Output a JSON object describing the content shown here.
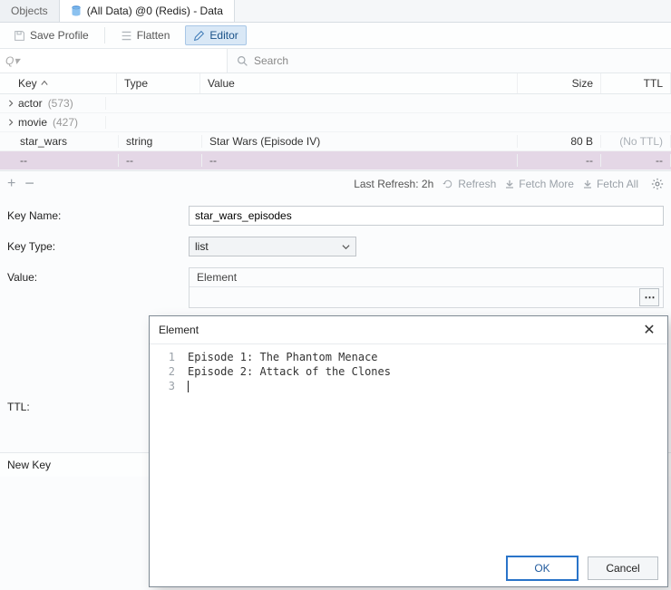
{
  "tabs": {
    "objects": "Objects",
    "active": "(All Data) @0 (Redis) - Data"
  },
  "toolbar": {
    "save_profile": "Save Profile",
    "flatten": "Flatten",
    "editor": "Editor"
  },
  "search": {
    "placeholder": "Q▾",
    "button": "Search"
  },
  "columns": {
    "key": "Key",
    "type": "Type",
    "value": "Value",
    "size": "Size",
    "ttl": "TTL"
  },
  "rows": {
    "actor": {
      "name": "actor",
      "count": "(573)"
    },
    "movie": {
      "name": "movie",
      "count": "(427)"
    },
    "star_wars": {
      "name": "star_wars",
      "type": "string",
      "value": "Star Wars (Episode IV)",
      "size": "80 B",
      "ttl": "(No TTL)"
    },
    "dash": {
      "key": "--",
      "type": "--",
      "value": "--",
      "size": "--",
      "ttl": "--"
    }
  },
  "footer": {
    "last_refresh": "Last Refresh: 2h",
    "refresh": "Refresh",
    "fetch_more": "Fetch More",
    "fetch_all": "Fetch All"
  },
  "form": {
    "key_name_label": "Key Name:",
    "key_name_value": "star_wars_episodes",
    "key_type_label": "Key Type:",
    "key_type_value": "list",
    "value_label": "Value:",
    "value_header": "Element",
    "ttl_label": "TTL:"
  },
  "bottom_bar": {
    "new_key": "New Key"
  },
  "modal": {
    "title": "Element",
    "lines": {
      "l1": "Episode 1: The Phantom Menace",
      "l2": "Episode 2: Attack of the Clones"
    },
    "gutter": "1\n2\n3",
    "ok": "OK",
    "cancel": "Cancel"
  }
}
